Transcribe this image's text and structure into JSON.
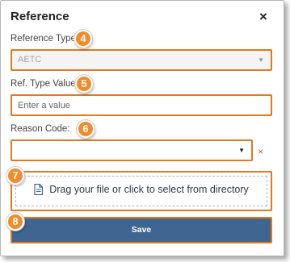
{
  "dialog": {
    "title": "Reference",
    "close_glyph": "×"
  },
  "reference_type": {
    "label": "Reference Type:",
    "value": "AETC",
    "badge": "4"
  },
  "ref_type_value": {
    "label": "Ref. Type Value:",
    "placeholder": "Enter a value",
    "value": "",
    "badge": "5"
  },
  "reason_code": {
    "label": "Reason Code:",
    "value": "",
    "badge": "6",
    "clear_glyph": "×"
  },
  "upload": {
    "text": "Drag your file or click to select from directory",
    "icon": "document-icon",
    "badge": "7"
  },
  "save": {
    "label": "Save",
    "badge": "8"
  },
  "colors": {
    "highlight_border": "#e07a1f",
    "badge": "#f08c2a",
    "save_button": "#3f6591",
    "clear_icon": "#d9534f",
    "upload_icon": "#3f6591"
  }
}
